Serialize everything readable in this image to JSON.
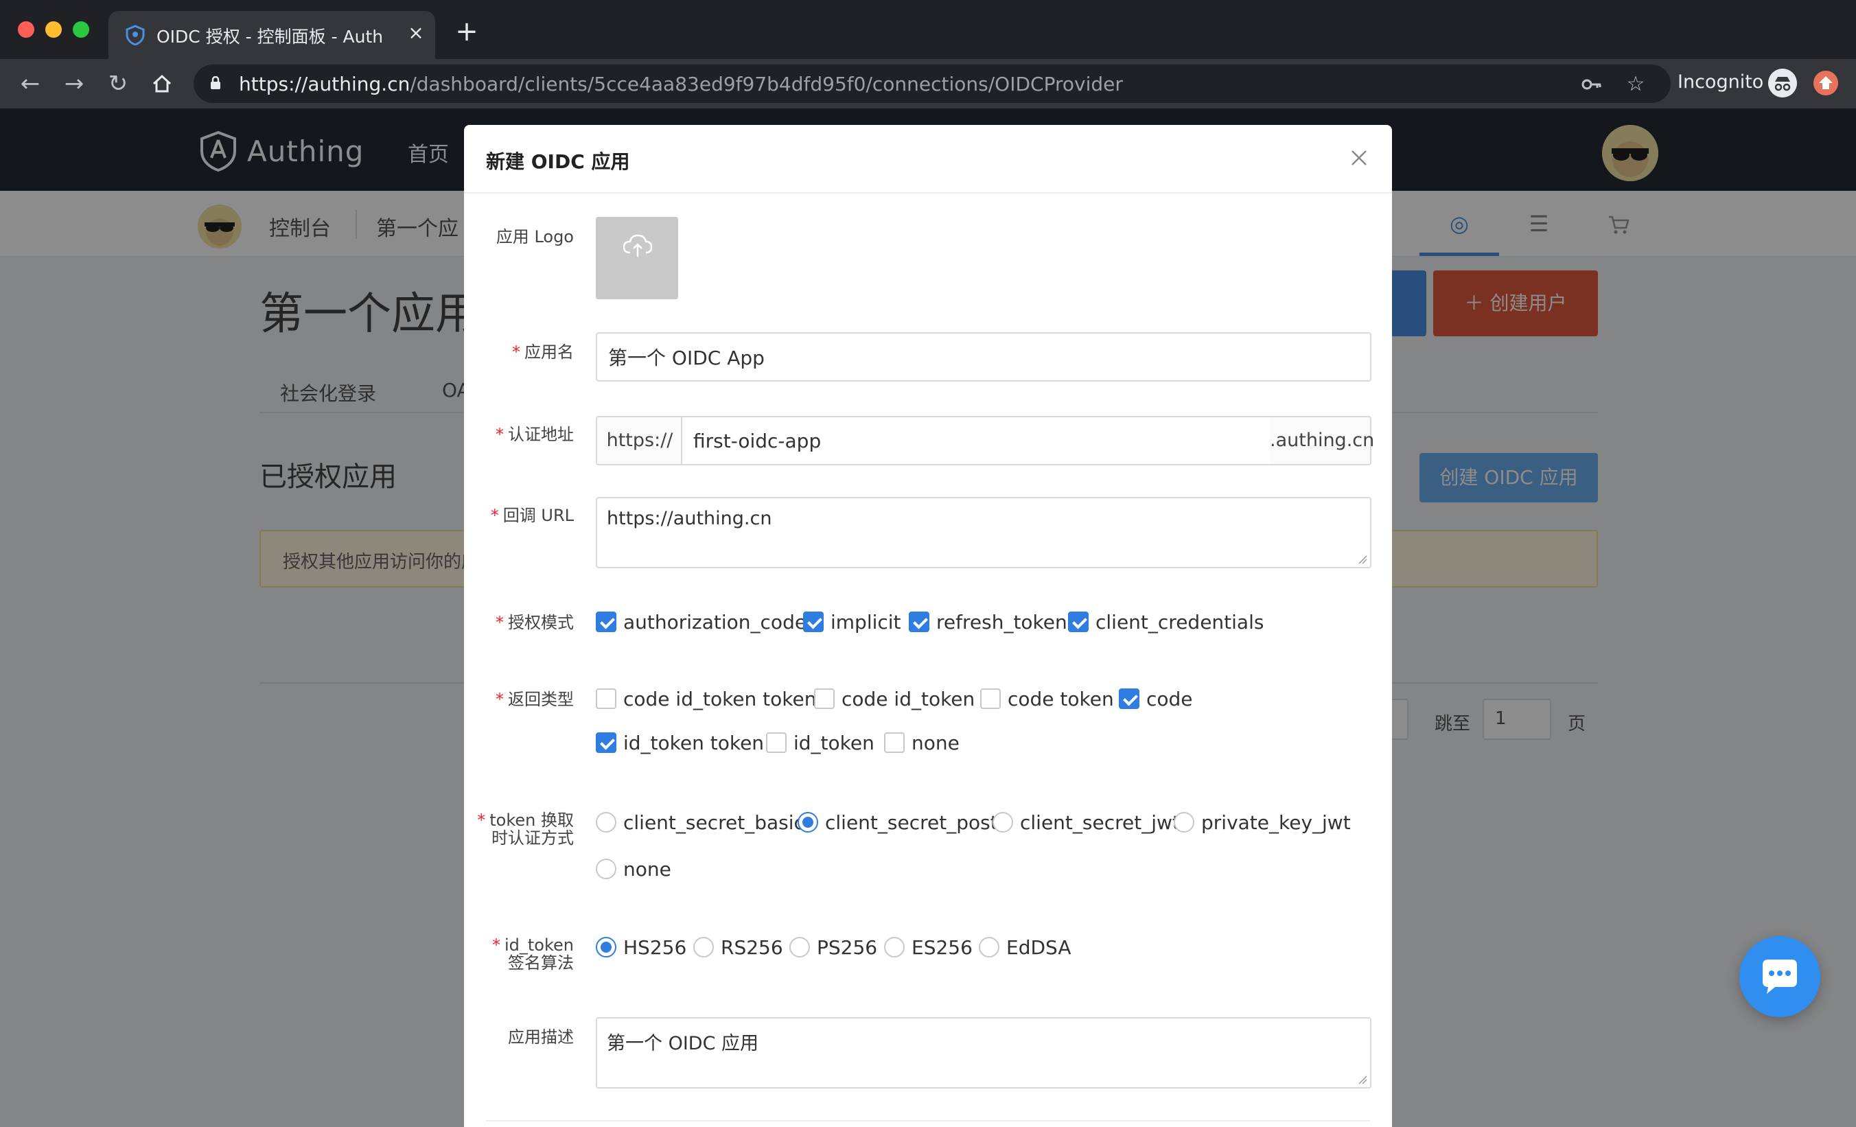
{
  "browser": {
    "tab_title": "OIDC 授权 - 控制面板 - Authing",
    "tab_close": "×",
    "new_tab": "+",
    "url_host": "https://authing.cn",
    "url_path": "/dashboard/clients/5cce4aa83ed9f97b4dfd95f0/connections/OIDCProvider",
    "incognito_label": "Incognito",
    "icons": [
      "back-icon",
      "forward-icon",
      "reload-icon",
      "home-icon",
      "lock-icon",
      "key-icon",
      "star-icon",
      "incognito-icon",
      "extension-icon"
    ],
    "traffic_colors": [
      "#ff5f57",
      "#febc2e",
      "#28c840"
    ]
  },
  "topnav": {
    "logo_text": "Authing",
    "home_label": "首页"
  },
  "subnav": {
    "console_label": "控制台",
    "app_label": "第一个应"
  },
  "page": {
    "title": "第一个应用",
    "create_user_label": "＋  创建用户",
    "tabs": [
      "社会化登录",
      "OA"
    ],
    "section_title": "已授权应用",
    "create_oidc_label": "创建 OIDC 应用",
    "alert_text": "授权其他应用访问你的应",
    "pager_jump_label": "跳至",
    "pager_page_value": "1",
    "pager_page_suffix": "页"
  },
  "modal": {
    "title": "新建 OIDC 应用",
    "logo_label": "应用 Logo",
    "app_name_label": "应用名",
    "app_name_value": "第一个 OIDC App",
    "auth_addr_label": "认证地址",
    "auth_addr_prefix": "https://",
    "auth_addr_value": "first-oidc-app",
    "auth_addr_suffix": ".authing.cn",
    "callback_label": "回调 URL",
    "callback_value": "https://authing.cn",
    "grant_label": "授权模式",
    "grant_options": [
      {
        "label": "authorization_code",
        "checked": true
      },
      {
        "label": "implicit",
        "checked": true
      },
      {
        "label": "refresh_token",
        "checked": true
      },
      {
        "label": "client_credentials",
        "checked": true
      }
    ],
    "response_label": "返回类型",
    "response_options": [
      {
        "label": "code id_token token",
        "checked": false
      },
      {
        "label": "code id_token",
        "checked": false
      },
      {
        "label": "code token",
        "checked": false
      },
      {
        "label": "code",
        "checked": true
      },
      {
        "label": "id_token token",
        "checked": true
      },
      {
        "label": "id_token",
        "checked": false
      },
      {
        "label": "none",
        "checked": false
      }
    ],
    "token_auth_label_1": "token 换取",
    "token_auth_label_2": "时认证方式",
    "token_auth_options": [
      {
        "label": "client_secret_basic",
        "selected": false
      },
      {
        "label": "client_secret_post",
        "selected": true
      },
      {
        "label": "client_secret_jwt",
        "selected": false
      },
      {
        "label": "private_key_jwt",
        "selected": false
      },
      {
        "label": "none",
        "selected": false
      }
    ],
    "sign_alg_label_1": "id_token",
    "sign_alg_label_2": "签名算法",
    "sign_alg_options": [
      {
        "label": "HS256",
        "selected": true
      },
      {
        "label": "RS256",
        "selected": false
      },
      {
        "label": "PS256",
        "selected": false
      },
      {
        "label": "ES256",
        "selected": false
      },
      {
        "label": "EdDSA",
        "selected": false
      }
    ],
    "desc_label": "应用描述",
    "desc_value": "第一个 OIDC 应用"
  },
  "colors": {
    "accent": "#2f7de1",
    "required": "#f5222d",
    "create_user_btn": "#e05a3c",
    "chat_bubble": "#2f8ef0"
  }
}
